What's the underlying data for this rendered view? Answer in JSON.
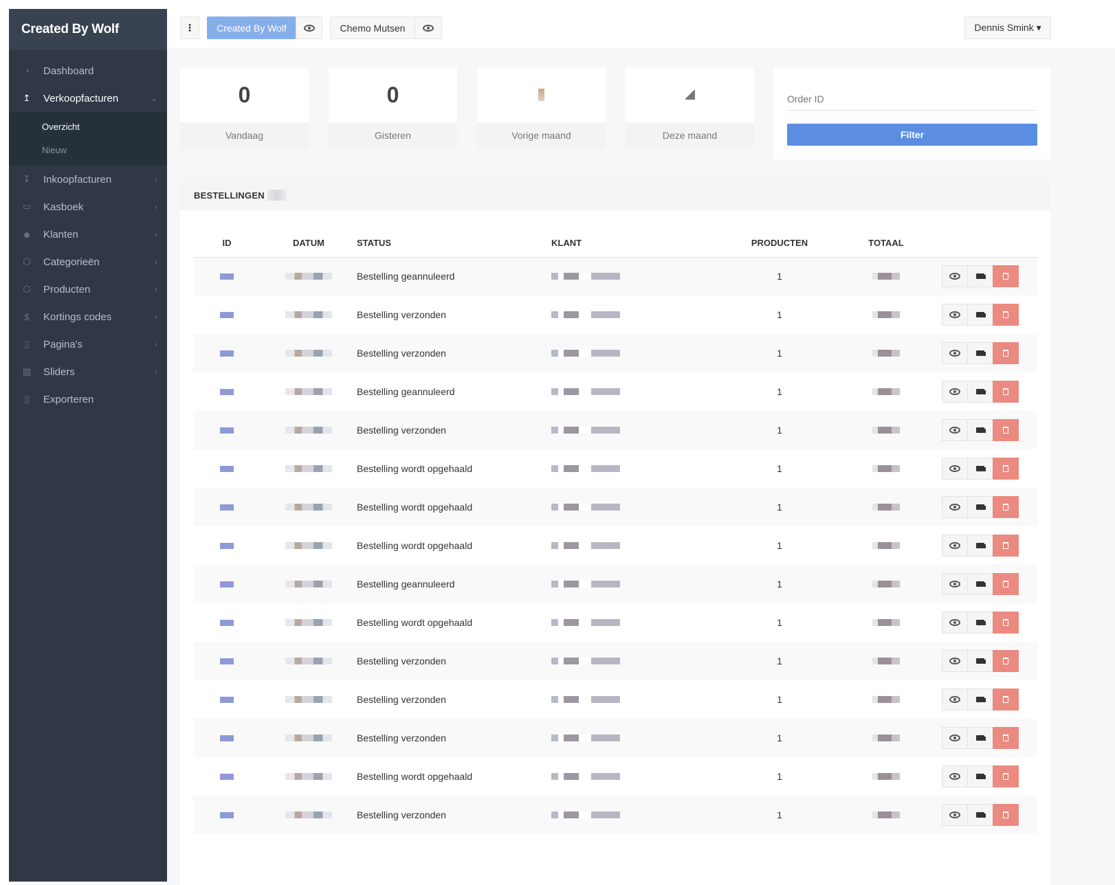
{
  "sidebar": {
    "brand": "Created By Wolf",
    "items": [
      {
        "label": "Dashboard",
        "icon": "dashboard-icon",
        "active": false,
        "chevron": ""
      },
      {
        "label": "Verkoopfacturen",
        "icon": "upload-arrow-icon",
        "active": true,
        "chevron": "⌄"
      },
      {
        "label": "Inkoopfacturen",
        "icon": "download-arrow-icon",
        "active": false,
        "chevron": "‹"
      },
      {
        "label": "Kasboek",
        "icon": "money-icon",
        "active": false,
        "chevron": "‹"
      },
      {
        "label": "Klanten",
        "icon": "users-icon",
        "active": false,
        "chevron": "‹"
      },
      {
        "label": "Categorieën",
        "icon": "cube-icon",
        "active": false,
        "chevron": "‹"
      },
      {
        "label": "Producten",
        "icon": "cube-icon",
        "active": false,
        "chevron": "‹"
      },
      {
        "label": "Kortings codes",
        "icon": "dollar-icon",
        "active": false,
        "chevron": "‹"
      },
      {
        "label": "Pagina's",
        "icon": "file-icon",
        "active": false,
        "chevron": "‹"
      },
      {
        "label": "Sliders",
        "icon": "image-icon",
        "active": false,
        "chevron": "‹"
      },
      {
        "label": "Exporteren",
        "icon": "file-excel-icon",
        "active": false,
        "chevron": ""
      }
    ],
    "subitems": [
      {
        "label": "Overzicht",
        "active": true
      },
      {
        "label": "Nieuw",
        "active": false
      }
    ]
  },
  "topbar": {
    "menu_icon": "vertical-dots-icon",
    "shop1": "Created By Wolf",
    "shop2": "Chemo Mutsen",
    "user": "Dennis Smink ▾"
  },
  "stats": [
    {
      "value": "0",
      "caption": "Vandaag"
    },
    {
      "value": "0",
      "caption": "Gisteren"
    },
    {
      "value": "",
      "caption": "Vorige maand"
    },
    {
      "value": "",
      "caption": "Deze maand"
    }
  ],
  "filter": {
    "placeholder": "Order ID",
    "button": "Filter"
  },
  "orders": {
    "title": "BESTELLINGEN",
    "columns": [
      "ID",
      "DATUM",
      "STATUS",
      "KLANT",
      "PRODUCTEN",
      "TOTAAL"
    ],
    "rows": [
      {
        "status": "Bestelling geannuleerd",
        "products": "1"
      },
      {
        "status": "Bestelling verzonden",
        "products": "1"
      },
      {
        "status": "Bestelling verzonden",
        "products": "1"
      },
      {
        "status": "Bestelling geannuleerd",
        "products": "1"
      },
      {
        "status": "Bestelling verzonden",
        "products": "1"
      },
      {
        "status": "Bestelling wordt opgehaald",
        "products": "1"
      },
      {
        "status": "Bestelling wordt opgehaald",
        "products": "1"
      },
      {
        "status": "Bestelling wordt opgehaald",
        "products": "1"
      },
      {
        "status": "Bestelling geannuleerd",
        "products": "1"
      },
      {
        "status": "Bestelling wordt opgehaald",
        "products": "1"
      },
      {
        "status": "Bestelling verzonden",
        "products": "1"
      },
      {
        "status": "Bestelling verzonden",
        "products": "1"
      },
      {
        "status": "Bestelling verzonden",
        "products": "1"
      },
      {
        "status": "Bestelling wordt opgehaald",
        "products": "1"
      },
      {
        "status": "Bestelling verzonden",
        "products": "1"
      }
    ]
  },
  "colors": {
    "sidebar": "#2f3844",
    "primary": "#5b8ee0",
    "delete": "#ea8a80"
  }
}
